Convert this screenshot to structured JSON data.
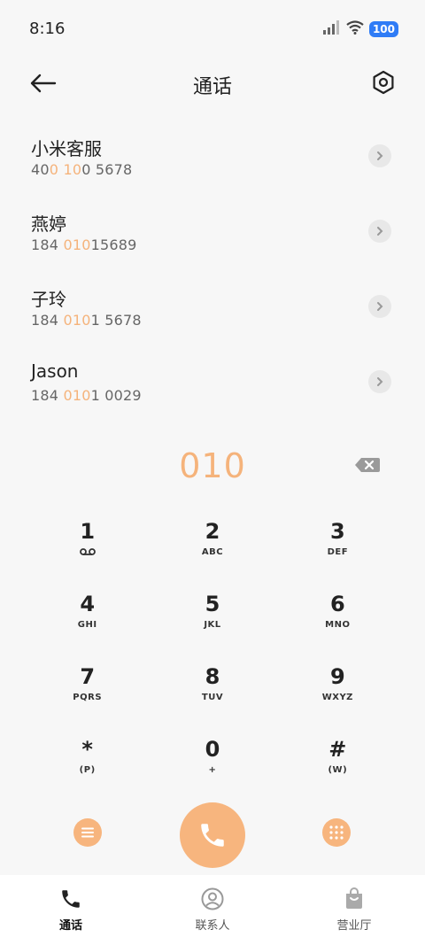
{
  "status_bar": {
    "time": "8:16",
    "battery": "100"
  },
  "header": {
    "title": "通话"
  },
  "results": [
    {
      "name": "小米客服",
      "number_parts": [
        {
          "t": "40",
          "h": false
        },
        {
          "t": "0",
          "h": true
        },
        {
          "t": " ",
          "h": false
        },
        {
          "t": "10",
          "h": true
        },
        {
          "t": "0 5678",
          "h": false
        }
      ]
    },
    {
      "name": "燕婷",
      "number_parts": [
        {
          "t": "184 ",
          "h": false
        },
        {
          "t": "010",
          "h": true
        },
        {
          "t": "15689",
          "h": false
        }
      ]
    },
    {
      "name": "子玲",
      "number_parts": [
        {
          "t": "184 ",
          "h": false
        },
        {
          "t": "010",
          "h": true
        },
        {
          "t": "1 5678",
          "h": false
        }
      ]
    },
    {
      "name": "Jason",
      "number_parts": [
        {
          "t": "184 ",
          "h": false
        },
        {
          "t": "010",
          "h": true
        },
        {
          "t": "1 0029",
          "h": false
        }
      ]
    }
  ],
  "dial": {
    "entered": "010"
  },
  "keypad": [
    {
      "digit": "1",
      "letters": "",
      "voicemail": true
    },
    {
      "digit": "2",
      "letters": "ABC"
    },
    {
      "digit": "3",
      "letters": "DEF"
    },
    {
      "digit": "4",
      "letters": "GHI"
    },
    {
      "digit": "5",
      "letters": "JKL"
    },
    {
      "digit": "6",
      "letters": "MNO"
    },
    {
      "digit": "7",
      "letters": "PQRS"
    },
    {
      "digit": "8",
      "letters": "TUV"
    },
    {
      "digit": "9",
      "letters": "WXYZ"
    },
    {
      "digit": "*",
      "letters": "(P)"
    },
    {
      "digit": "0",
      "letters": "+"
    },
    {
      "digit": "#",
      "letters": "(W)"
    }
  ],
  "bottom_nav": {
    "items": [
      {
        "label": "通话",
        "icon": "phone-icon",
        "active": true
      },
      {
        "label": "联系人",
        "icon": "contacts-icon",
        "active": false
      },
      {
        "label": "营业厅",
        "icon": "shopping-bag-icon",
        "active": false
      }
    ]
  },
  "colors": {
    "accent": "#f7b57e",
    "highlight_text": "#f5b37b",
    "battery": "#2f7cf6"
  }
}
